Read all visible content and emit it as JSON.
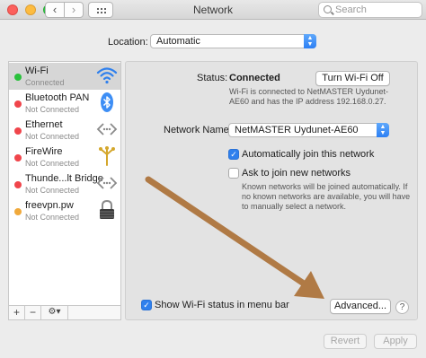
{
  "window": {
    "title": "Network"
  },
  "search": {
    "placeholder": "Search"
  },
  "location": {
    "label": "Location:",
    "value": "Automatic"
  },
  "services": [
    {
      "name": "Wi-Fi",
      "status": "Connected",
      "status_color": "#29c13b",
      "icon": "wifi-icon",
      "selected": true
    },
    {
      "name": "Bluetooth PAN",
      "status": "Not Connected",
      "status_color": "#f0454b",
      "icon": "bluetooth-icon"
    },
    {
      "name": "Ethernet",
      "status": "Not Connected",
      "status_color": "#f0454b",
      "icon": "ethernet-arrows-icon"
    },
    {
      "name": "FireWire",
      "status": "Not Connected",
      "status_color": "#f0454b",
      "icon": "firewire-icon"
    },
    {
      "name": "Thunde...lt Bridge",
      "status": "Not Connected",
      "status_color": "#f0454b",
      "icon": "thunderbolt-arrows-icon"
    },
    {
      "name": "freevpn.pw",
      "status": "Not Connected",
      "status_color": "#f0a93b",
      "icon": "vpn-lock-icon"
    }
  ],
  "sidebar_toolbar": {
    "add": "+",
    "remove": "−",
    "action": "⚙▾"
  },
  "main": {
    "status_label": "Status:",
    "status_value": "Connected",
    "turn_off_button": "Turn Wi-Fi Off",
    "status_desc_1": "Wi-Fi is connected to NetMASTER Uydunet-",
    "status_desc_2": "AE60 and has the IP address 192.168.0.27.",
    "network_name_label": "Network Name:",
    "network_name_value": "NetMASTER Uydunet-AE60",
    "auto_join_label": "Automatically join this network",
    "ask_join_label": "Ask to join new networks",
    "ask_desc_1": "Known networks will be joined automatically. If",
    "ask_desc_2": "no known networks are available, you will have",
    "ask_desc_3": "to manually select a network.",
    "show_status_label": "Show Wi-Fi status in menu bar",
    "advanced_button": "Advanced...",
    "help_button": "?"
  },
  "footer": {
    "revert": "Revert",
    "apply": "Apply"
  },
  "colors": {
    "accent": "#2f80ed",
    "annotation_arrow": "#b07a45"
  }
}
